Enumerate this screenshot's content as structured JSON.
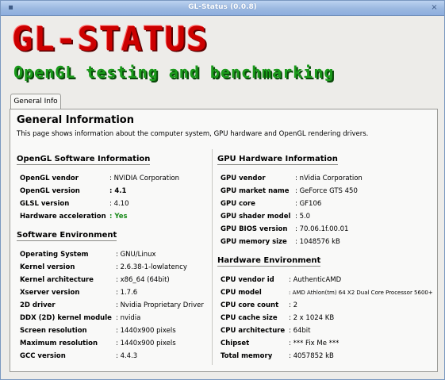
{
  "window": {
    "title": "GL-Status (0.0.8)",
    "close_glyph": "×"
  },
  "banner": {
    "logo": "GL-STATUS",
    "subtitle": "OpenGL testing and benchmarking"
  },
  "tabs": [
    {
      "label": "General Info"
    }
  ],
  "page": {
    "title": "General Information",
    "description": "This page shows information about the computer system, GPU hardware and OpenGL rendering drivers."
  },
  "sections": {
    "opengl": {
      "heading": "OpenGL Software Information",
      "rows": [
        {
          "key": "OpenGL vendor",
          "value": ": NVIDIA Corporation"
        },
        {
          "key": "OpenGL version",
          "value": ": 4.1"
        },
        {
          "key": "GLSL version",
          "value": ": 4.10"
        },
        {
          "key": "Hardware acceleration",
          "value": ": Yes"
        }
      ]
    },
    "software": {
      "heading": "Software Environment",
      "rows": [
        {
          "key": "Operating System",
          "value": ": GNU/Linux"
        },
        {
          "key": "Kernel version",
          "value": ": 2.6.38-1-lowlatency"
        },
        {
          "key": "Kernel architecture",
          "value": ": x86_64 (64bit)"
        },
        {
          "key": "Xserver version",
          "value": ": 1.7.6"
        },
        {
          "key": "2D driver",
          "value": ": Nvidia Proprietary Driver"
        },
        {
          "key": "DDX (2D) kernel module",
          "value": ": nvidia"
        },
        {
          "key": "Screen resolution",
          "value": ": 1440x900 pixels"
        },
        {
          "key": "Maximum resolution",
          "value": ": 1440x900 pixels"
        },
        {
          "key": "GCC version",
          "value": ": 4.4.3"
        }
      ]
    },
    "gpu": {
      "heading": "GPU Hardware Information",
      "rows": [
        {
          "key": "GPU vendor",
          "value": ": nVidia Corporation"
        },
        {
          "key": "GPU market name",
          "value": ": GeForce GTS 450"
        },
        {
          "key": "GPU core",
          "value": ": GF106"
        },
        {
          "key": "GPU shader model",
          "value": ": 5.0"
        },
        {
          "key": "GPU BIOS version",
          "value": ": 70.06.1f.00.01"
        },
        {
          "key": "GPU memory size",
          "value": ": 1048576 kB"
        }
      ]
    },
    "hardware": {
      "heading": "Hardware Environment",
      "rows": [
        {
          "key": "CPU vendor id",
          "value": ": AuthenticAMD"
        },
        {
          "key": "CPU model",
          "value": ": AMD Athlon(tm) 64 X2 Dual Core Processor 5600+"
        },
        {
          "key": "CPU core count",
          "value": ": 2"
        },
        {
          "key": "CPU cache size",
          "value": ": 2 x 1024 KB"
        },
        {
          "key": "CPU architecture",
          "value": ": 64bit"
        },
        {
          "key": "Chipset",
          "value": ": *** Fix Me ***"
        },
        {
          "key": "Total memory",
          "value": ": 4057852 kB"
        }
      ]
    }
  }
}
